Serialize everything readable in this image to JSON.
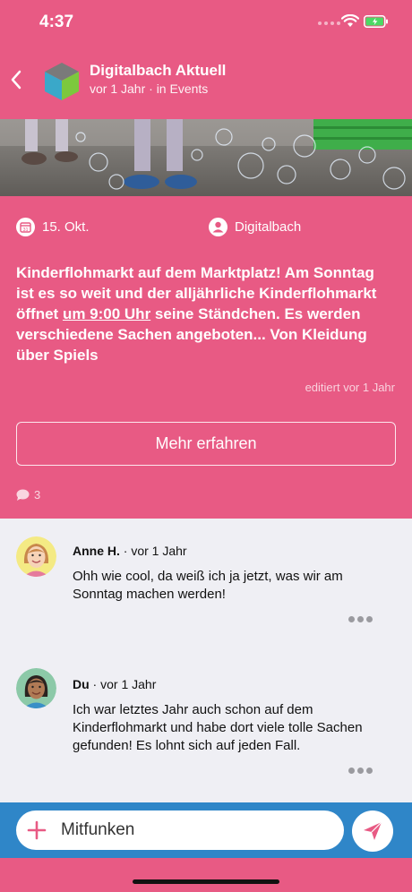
{
  "status_bar": {
    "time": "4:37"
  },
  "header": {
    "title": "Digitalbach Aktuell",
    "subtitle": "vor 1 Jahr · in Events"
  },
  "post": {
    "date": "15. Okt.",
    "author": "Digitalbach",
    "text_before": "Kinderflohmarkt auf dem Marktplatz! Am Sonntag ist es so weit und der alljährliche Kinderflohmarkt öffnet ",
    "text_link": "um 9:00 Uhr",
    "text_after": " seine Ständchen. Es werden verschiedene Sachen angeboten... Von Kleidung über Spiels",
    "edited": "editiert vor 1 Jahr",
    "more_button": "Mehr erfahren",
    "comment_count": "3"
  },
  "comments": [
    {
      "author": "Anne H.",
      "time": " · vor 1 Jahr",
      "text": "Ohh wie cool, da weiß ich ja jetzt, was wir am Sonntag machen werden!"
    },
    {
      "author": "Du",
      "time": " · vor 1 Jahr",
      "text": "Ich war letztes Jahr auch schon auf dem Kinderflohmarkt und habe dort viele tolle Sachen gefunden! Es lohnt sich auf jeden Fall."
    }
  ],
  "composer": {
    "placeholder": "Mitfunken"
  },
  "colors": {
    "brand_pink": "#e85a84",
    "composer_blue": "#2f86c8",
    "comments_bg": "#efeff4"
  },
  "icons": {
    "back": "chevron-left-icon",
    "calendar": "calendar-icon",
    "person": "person-icon",
    "comment": "speech-bubble-icon",
    "plus": "plus-icon",
    "send": "paper-plane-icon",
    "more": "ellipsis-icon"
  }
}
